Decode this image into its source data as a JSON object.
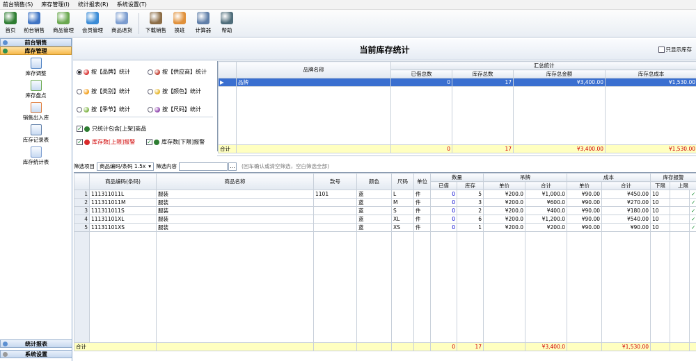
{
  "menu": [
    "前台销售(S)",
    "库存管理(I)",
    "统计报表(R)",
    "系统设置(T)"
  ],
  "toolbar": [
    {
      "label": "首页",
      "icon": "home-icon",
      "color": "#2e7d32"
    },
    {
      "label": "前台销售",
      "icon": "cashier-icon",
      "color": "#3f74c4"
    },
    {
      "label": "商品管理",
      "icon": "goods-icon",
      "color": "#6aa84f"
    },
    {
      "label": "会员管理",
      "icon": "member-icon",
      "color": "#3a8bd6"
    },
    {
      "label": "商品退货",
      "icon": "return-icon",
      "color": "#7b9ccf"
    },
    {
      "label": "下载销售",
      "icon": "download-icon",
      "color": "#8c6d46"
    },
    {
      "label": "换班",
      "icon": "shift-icon",
      "color": "#e0903a"
    },
    {
      "label": "计算器",
      "icon": "calculator-icon",
      "color": "#5f7ea8"
    },
    {
      "label": "帮助",
      "icon": "help-icon",
      "color": "#4f6d7a"
    }
  ],
  "sidebar": {
    "top": "前台销售",
    "active": "库存管理",
    "items": [
      "库存调整",
      "库存盘点",
      "销售出入库",
      "库存记录表",
      "库存统计表"
    ],
    "bottom": [
      "统计报表",
      "系统设置"
    ]
  },
  "title": "当前库存统计",
  "show_zero_label": "只显示库存",
  "options": {
    "radios": [
      {
        "label": "按【品牌】统计",
        "ball": "#d92b2b",
        "checked": true
      },
      {
        "label": "按【供应商】统计",
        "ball": "#c0392b",
        "checked": false
      },
      {
        "label": "按【类别】统计",
        "ball": "#f39c12",
        "checked": false
      },
      {
        "label": "按【颜色】统计",
        "ball": "#e6b422",
        "checked": false
      },
      {
        "label": "按【季节】统计",
        "ball": "#7cb342",
        "checked": false
      },
      {
        "label": "按【尺码】统计",
        "ball": "#8e44ad",
        "checked": false
      }
    ],
    "checks": [
      {
        "label": "只统计包含[上架]商品",
        "checked": true
      },
      {
        "label": "库存数[上限]报警",
        "checked": true,
        "red": true
      },
      {
        "label": "库存数[下限]报警",
        "checked": true,
        "red": false
      }
    ]
  },
  "summary": {
    "name_header": "品牌名称",
    "group_header": "汇总统计",
    "columns": [
      "已借总数",
      "库存总数",
      "库存总金额",
      "库存总成本"
    ],
    "rows": [
      {
        "name": "品牌",
        "lent": "0",
        "qty": "17",
        "amount": "¥3,400.00",
        "cost": "¥1,530.00"
      }
    ],
    "total": {
      "label": "合计",
      "lent": "0",
      "qty": "17",
      "amount": "¥3,400.00",
      "cost": "¥1,530.00"
    }
  },
  "filter": {
    "label": "筛选项目",
    "select_value": "商品编码/条码 1.5x",
    "content_label": "筛选内容",
    "hint": "(回车确认或清空筛选，空白筛选全部)"
  },
  "grid": {
    "headers": {
      "code": "商品编码(条码)",
      "name": "商品名称",
      "style": "款号",
      "color": "颜色",
      "size": "尺码",
      "unit": "单位",
      "qty_group": "数量",
      "lent": "已借",
      "stock": "库存",
      "tag_group": "吊牌",
      "unit_price": "单价",
      "price_total": "合计",
      "cost_group": "成本",
      "unit_cost": "单价",
      "cost_total": "合计",
      "alarm_group": "库存报警",
      "lower": "下限",
      "upper": "上限"
    },
    "rows": [
      {
        "no": "1",
        "code": "111311011L",
        "name": "服装",
        "style": "1101",
        "color": "蓝",
        "size": "L",
        "unit": "件",
        "lent": "0",
        "stock": "5",
        "price": "¥200.0",
        "ptotal": "¥1,000.0",
        "cost": "¥90.00",
        "ctotal": "¥450.00",
        "lower": "10"
      },
      {
        "no": "2",
        "code": "111311011M",
        "name": "服装",
        "style": "",
        "color": "蓝",
        "size": "M",
        "unit": "件",
        "lent": "0",
        "stock": "3",
        "price": "¥200.0",
        "ptotal": "¥600.0",
        "cost": "¥90.00",
        "ctotal": "¥270.00",
        "lower": "10"
      },
      {
        "no": "3",
        "code": "111311011S",
        "name": "服装",
        "style": "",
        "color": "蓝",
        "size": "S",
        "unit": "件",
        "lent": "0",
        "stock": "2",
        "price": "¥200.0",
        "ptotal": "¥400.0",
        "cost": "¥90.00",
        "ctotal": "¥180.00",
        "lower": "10"
      },
      {
        "no": "4",
        "code": "11131101XL",
        "name": "服装",
        "style": "",
        "color": "蓝",
        "size": "XL",
        "unit": "件",
        "lent": "0",
        "stock": "6",
        "price": "¥200.0",
        "ptotal": "¥1,200.0",
        "cost": "¥90.00",
        "ctotal": "¥540.00",
        "lower": "10"
      },
      {
        "no": "5",
        "code": "11131101XS",
        "name": "服装",
        "style": "",
        "color": "蓝",
        "size": "XS",
        "unit": "件",
        "lent": "0",
        "stock": "1",
        "price": "¥200.0",
        "ptotal": "¥200.0",
        "cost": "¥90.00",
        "ctotal": "¥90.00",
        "lower": "10"
      }
    ],
    "total": {
      "label": "合计",
      "lent": "0",
      "stock": "17",
      "ptotal": "¥3,400.0",
      "ctotal": "¥1,530.00"
    }
  }
}
